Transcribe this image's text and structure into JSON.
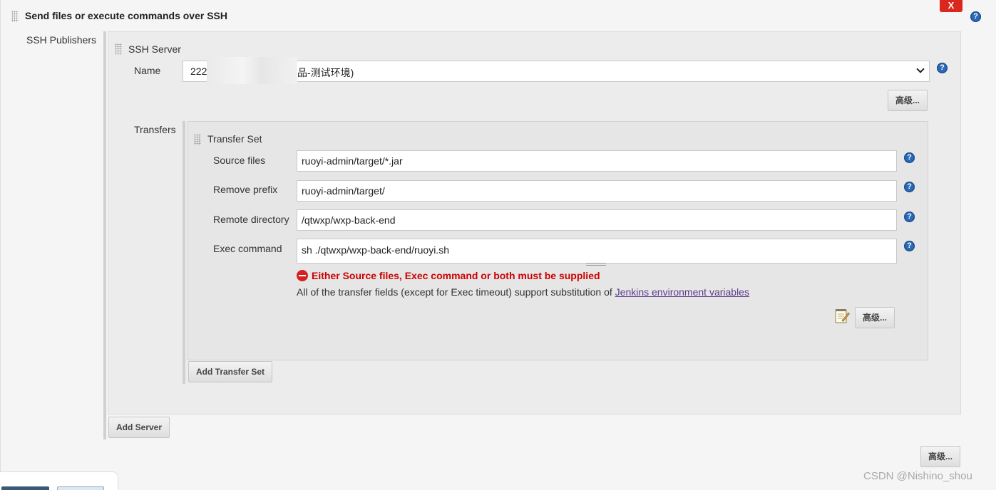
{
  "section": {
    "title": "Send files or execute commands over SSH",
    "close_label": "X",
    "help_symbol": "?"
  },
  "publishers": {
    "label": "SSH Publishers"
  },
  "ssh_server": {
    "title": "SSH Server",
    "name_label": "Name",
    "name_prefix": "222",
    "name_suffix": "品-测试环境)",
    "advanced_label": "高级..."
  },
  "transfers": {
    "label": "Transfers",
    "set_title": "Transfer Set",
    "fields": {
      "source_files": {
        "label": "Source files",
        "value": "ruoyi-admin/target/*.jar"
      },
      "remove_prefix": {
        "label": "Remove prefix",
        "value": "ruoyi-admin/target/"
      },
      "remote_directory": {
        "label": "Remote directory",
        "value": "/qtwxp/wxp-back-end"
      },
      "exec_command": {
        "label": "Exec command",
        "value": "sh ./qtwxp/wxp-back-end/ruoyi.sh"
      }
    },
    "error": "Either Source files, Exec command or both must be supplied",
    "note_text": "All of the transfer fields (except for Exec timeout) support substitution of ",
    "note_link": "Jenkins environment variables",
    "advanced_label": "高级...",
    "add_transfer_label": "Add Transfer Set"
  },
  "add_server_label": "Add Server",
  "bottom_advanced_label": "高级...",
  "watermark": "CSDN @Nishino_shou",
  "colors": {
    "close": "#d9281d",
    "error": "#cc0000",
    "help": "#2a6ab8",
    "link": "#5a3d8a"
  }
}
